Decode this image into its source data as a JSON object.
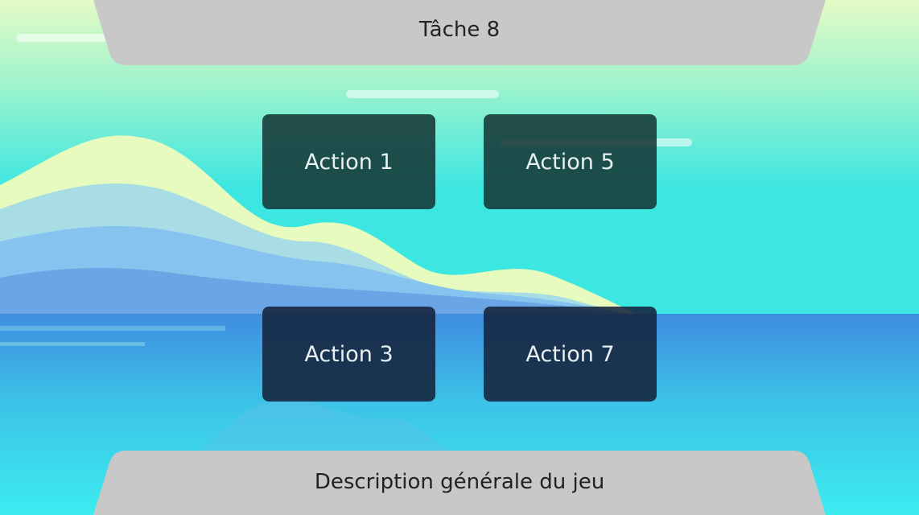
{
  "header": {
    "title": "Tâche 8"
  },
  "actions": [
    {
      "label": "Action 1"
    },
    {
      "label": "Action 5"
    },
    {
      "label": "Action 3"
    },
    {
      "label": "Action 7"
    }
  ],
  "footer": {
    "description": "Description générale du jeu"
  },
  "colors": {
    "sky_top": "#e4fbc6",
    "sky_bottom": "#3ce6e1",
    "water": "#3f8edf",
    "panel": "#c8c8c8",
    "button_upper": "#143737",
    "button_lower": "#14233c",
    "button_text": "#e8f0f2"
  }
}
